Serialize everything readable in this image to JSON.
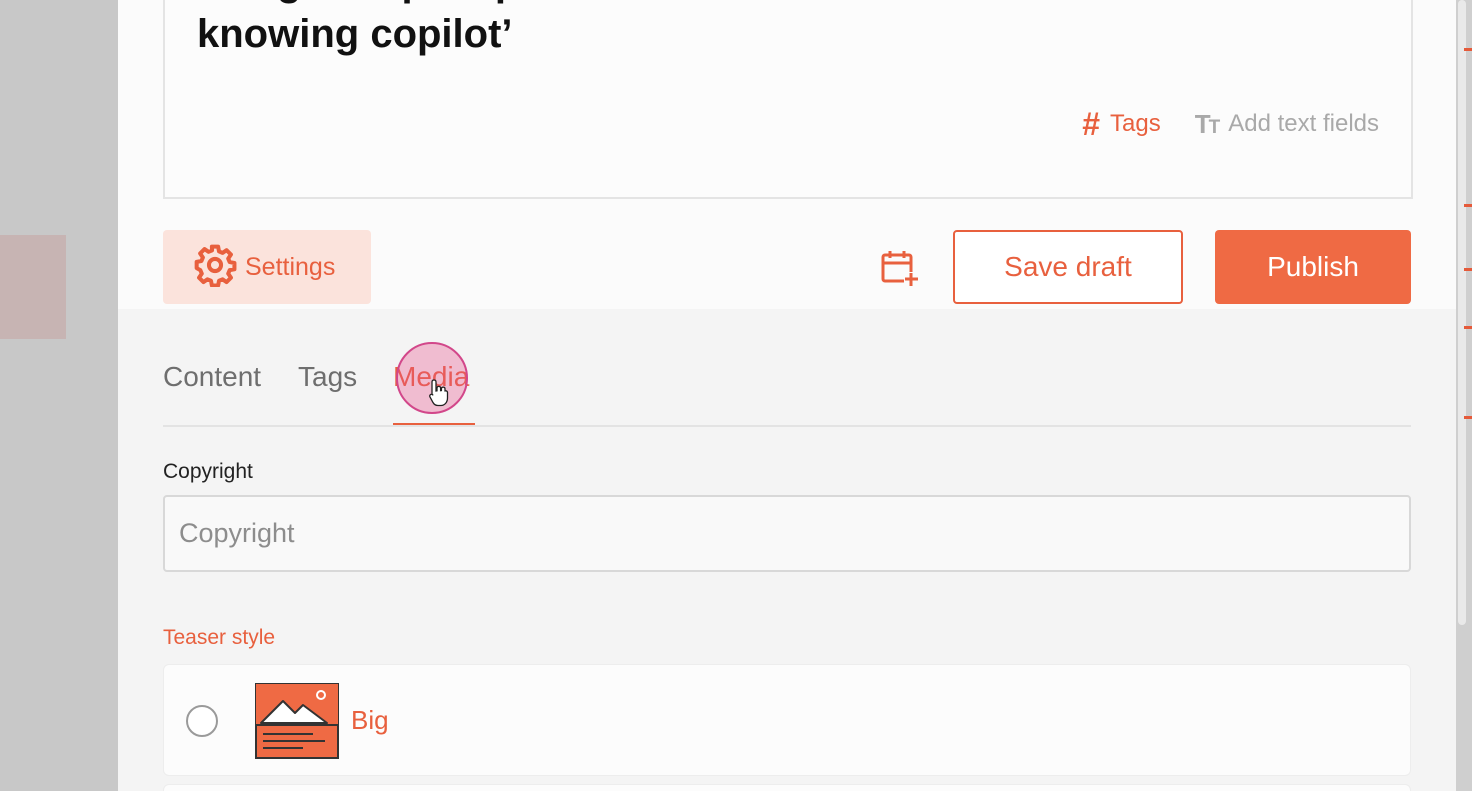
{
  "article": {
    "headline_line1": "Google Maps taps Gemini AI to transform into an ‘all-",
    "headline_line2": "knowing copilot’",
    "tags_action": "Tags",
    "text_fields_action": "Add text fields"
  },
  "toolbar": {
    "settings_label": "Settings",
    "save_draft_label": "Save draft",
    "publish_label": "Publish"
  },
  "tabs": [
    {
      "label": "Content",
      "active": false
    },
    {
      "label": "Tags",
      "active": false
    },
    {
      "label": "Media",
      "active": true
    }
  ],
  "media": {
    "copyright_label": "Copyright",
    "copyright_placeholder": "Copyright",
    "copyright_value": "",
    "teaser_style_label": "Teaser style",
    "teaser_options": [
      {
        "label": "Big",
        "selected": false
      }
    ]
  },
  "colors": {
    "accent": "#e8603e",
    "publish_bg": "#ef6a44",
    "settings_bg": "#fbe3dc",
    "cursor_highlight": "#d2478a"
  },
  "icons": {
    "settings": "gear-icon",
    "schedule": "calendar-plus-icon",
    "tags": "hashtag-icon",
    "text_fields": "text-size-icon",
    "teaser_big": "image-thumbnail-icon"
  }
}
